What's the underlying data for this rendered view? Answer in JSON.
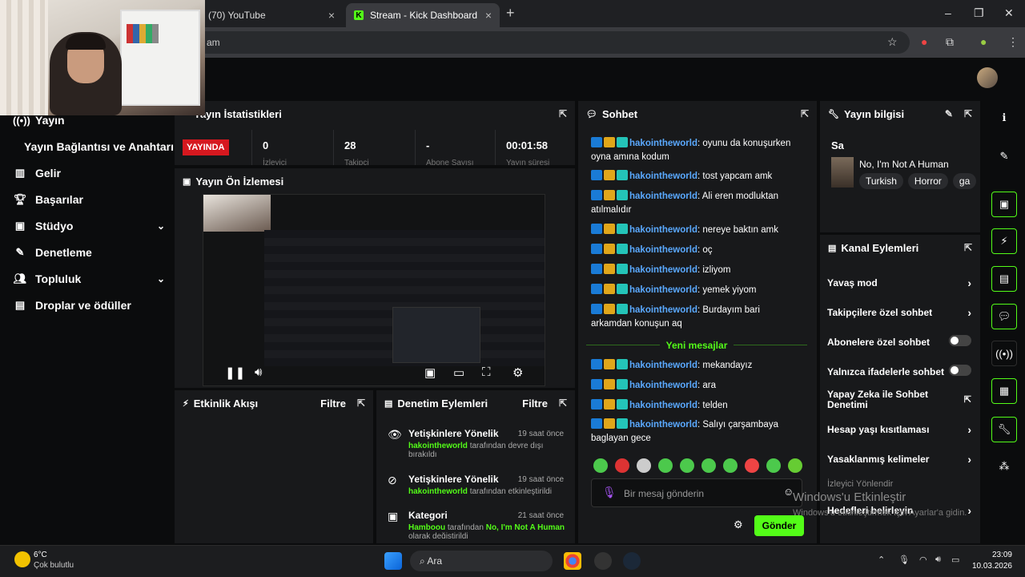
{
  "browser": {
    "tabs": [
      {
        "label": "(70) YouTube",
        "close": "×"
      },
      {
        "label": "Stream - Kick Dashboard",
        "close": "×"
      }
    ],
    "new_tab": "+",
    "url": "am",
    "window_controls": [
      "–",
      "❐",
      "✕"
    ]
  },
  "sidebar": {
    "items": [
      {
        "label": "Yayın",
        "icon": "stream-icon"
      },
      {
        "label": "Yayın Bağlantısı ve Anahtarı",
        "icon": ""
      },
      {
        "label": "Gelir",
        "icon": "bar-chart-icon"
      },
      {
        "label": "Başarılar",
        "icon": "trophy-icon"
      },
      {
        "label": "Stüdyo",
        "icon": "studio-icon",
        "chevron": "⌄"
      },
      {
        "label": "Denetleme",
        "icon": "wrench-icon"
      },
      {
        "label": "Topluluk",
        "icon": "people-icon",
        "chevron": "⌄"
      },
      {
        "label": "Droplar ve ödüller",
        "icon": "gift-icon"
      }
    ]
  },
  "stats": {
    "title": "Yayın İstatistikleri",
    "live_badge": "YAYINDA",
    "values": [
      "0",
      "28",
      "-",
      "00:01:58"
    ],
    "labels": [
      "İzleyici",
      "Takipçi",
      "Abone Sayısı",
      "Yayın süresi"
    ]
  },
  "preview": {
    "title": "Yayın Ön İzlemesi"
  },
  "activity": {
    "title": "Etkinlik Akışı",
    "filter": "Filtre"
  },
  "moderation": {
    "title": "Denetim Eylemleri",
    "filter": "Filtre",
    "rows": [
      {
        "title": "Yetişkinlere Yönelik",
        "time": "19 saat önce",
        "user": "hakointheworld",
        "desc": "tarafından devre dışı bırakıldı"
      },
      {
        "title": "Yetişkinlere Yönelik",
        "time": "19 saat önce",
        "user": "hakointheworld",
        "desc": "tarafından etkinleştirildi"
      },
      {
        "title": "Kategori",
        "time": "21 saat önce",
        "user": "Hamboou",
        "desc": "tarafından",
        "extra": "No, I'm Not A Human",
        "tail": "olarak değiştirildi"
      }
    ]
  },
  "chat": {
    "title": "Sohbet",
    "messages_before": [
      {
        "user": "hakointheworld",
        "text": "oyunu da konuşurken oyna amına kodum"
      },
      {
        "user": "hakointheworld",
        "text": "tost yapcam amk"
      },
      {
        "user": "hakointheworld",
        "text": "Ali eren modluktan atılmalıdır"
      },
      {
        "user": "hakointheworld",
        "text": "nereye baktın amk"
      },
      {
        "user": "hakointheworld",
        "text": "oç"
      },
      {
        "user": "hakointheworld",
        "text": "izliyom"
      },
      {
        "user": "hakointheworld",
        "text": "yemek yiyom"
      },
      {
        "user": "hakointheworld",
        "text": "Burdayım bari arkamdan konuşun aq"
      }
    ],
    "new_messages_label": "Yeni mesajlar",
    "messages_after": [
      {
        "user": "hakointheworld",
        "text": "mekandayız"
      },
      {
        "user": "hakointheworld",
        "text": "ara"
      },
      {
        "user": "hakointheworld",
        "text": "telden"
      },
      {
        "user": "hakointheworld",
        "text": "Salıyı çarşambaya baglayan gece"
      }
    ],
    "input_placeholder": "Bir mesaj gönderin",
    "send_label": "Gönder"
  },
  "stream_info": {
    "title": "Yayın bilgisi",
    "stream_title": "Sa",
    "category": "No, I'm Not A Human",
    "tags": [
      "Turkish",
      "Horror",
      "ga"
    ]
  },
  "channel_actions": {
    "title": "Kanal Eylemleri",
    "items": [
      {
        "label": "Yavaş mod",
        "kind": "chevron"
      },
      {
        "label": "Takipçilere özel sohbet",
        "kind": "chevron"
      },
      {
        "label": "Abonelere özel sohbet",
        "kind": "toggle"
      },
      {
        "label": "Yalnızca ifadelerle sohbet",
        "kind": "toggle"
      },
      {
        "label": "Yapay Zeka ile Sohbet Denetimi",
        "kind": "external"
      },
      {
        "label": "Hesap yaşı kısıtlaması",
        "kind": "chevron"
      },
      {
        "label": "Yasaklanmış kelimeler",
        "kind": "chevron"
      },
      {
        "label": "İzleyici Yönlendir",
        "kind": "none"
      },
      {
        "label": "Hedefleri belirleyin",
        "kind": "chevron"
      }
    ]
  },
  "watermark": {
    "line1": "Windows'u Etkinleştir",
    "line2": "Windows'u etkinleştirmek için Ayarlar'a gidin."
  },
  "taskbar": {
    "weather_temp": "6°C",
    "weather_desc": "Çok bulutlu",
    "search_label": "Ara",
    "time": "23:09",
    "date": "10.03.2026"
  },
  "colors": {
    "accent": "#53fc18",
    "live": "#d6181f",
    "username": "#5aa9ff",
    "panel": "#18191b"
  }
}
